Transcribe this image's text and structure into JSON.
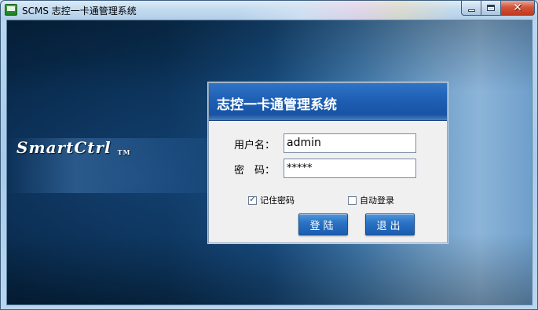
{
  "window": {
    "title": "SCMS 志控一卡通管理系统",
    "minimize_icon": "minimize-icon",
    "maximize_icon": "maximize-icon",
    "close_icon": "close-icon",
    "close_glyph": "✕"
  },
  "branding": {
    "logo_text": "SmartCtrl",
    "trademark": "TM"
  },
  "login": {
    "header_title": "志控一卡通管理系统",
    "username_label": "用户名：",
    "username_value": "admin",
    "password_label": "密　码：",
    "password_value": "*****",
    "remember_label": "记住密码",
    "remember_checked": true,
    "remember_mark": "✓",
    "autologin_label": "自动登录",
    "autologin_checked": false,
    "login_button": "登陆",
    "exit_button": "退出"
  },
  "colors": {
    "header_blue": "#1e5fb4",
    "button_blue": "#2b73c4",
    "close_red": "#d4553a",
    "background_navy": "#0a3156"
  }
}
